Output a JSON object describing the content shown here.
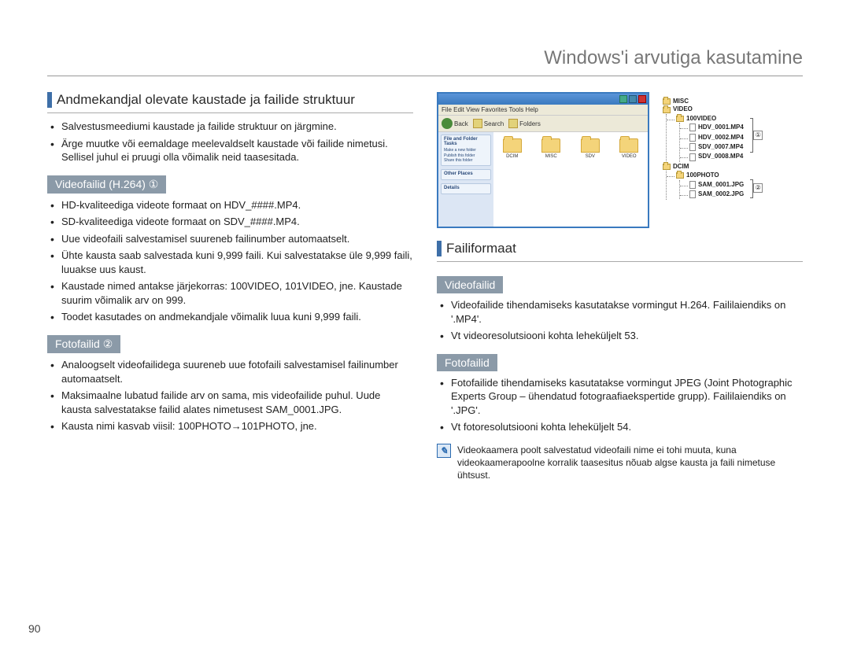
{
  "page_title": "Windows'i arvutiga kasutamine",
  "page_number": "90",
  "left": {
    "section_title": "Andmekandjal olevate kaustade ja failide struktuur",
    "intro_bullets": [
      "Salvestusmeediumi kaustade ja failide struktuur on järgmine.",
      "Ärge muutke või eemaldage meelevaldselt kaustade või failide nimetusi. Sellisel juhul ei pruugi olla võimalik neid taasesitada."
    ],
    "video_sub": "Videofailid (H.264) ①",
    "video_bullets": [
      "HD-kvaliteediga videote formaat on HDV_####.MP4.",
      "SD-kvaliteediga videote formaat on SDV_####.MP4.",
      "Uue videofaili salvestamisel suureneb failinumber automaatselt.",
      "Ühte kausta saab salvestada kuni 9,999 faili. Kui salvestatakse üle 9,999 faili, luuakse uus kaust.",
      "Kaustade nimed antakse järjekorras: 100VIDEO, 101VIDEO, jne. Kaustade suurim võimalik arv on 999.",
      "Toodet kasutades on andmekandjale võimalik luua kuni 9,999 faili."
    ],
    "photo_sub": "Fotofailid ②",
    "photo_bullets": [
      "Analoogselt videofailidega suureneb uue fotofaili salvestamisel failinumber automaatselt.",
      "Maksimaalne lubatud failide arv on sama, mis videofailide puhul. Uude kausta salvestatakse failid alates nimetusest SAM_0001.JPG.",
      "Kausta nimi kasvab viisil: 100PHOTO→101PHOTO, jne."
    ]
  },
  "right": {
    "explorer": {
      "menu": "File  Edit  View  Favorites  Tools  Help",
      "toolbar_back": "Back",
      "toolbar_search": "Search",
      "toolbar_folders": "Folders",
      "side_block1_hdr": "File and Folder Tasks",
      "side_block1_lines": [
        "Make a new folder",
        "Publish this folder",
        "Share this folder"
      ],
      "side_block2_hdr": "Other Places",
      "side_block3_hdr": "Details",
      "folders": [
        "DCIM",
        "MISC",
        "SDV",
        "VIDEO"
      ]
    },
    "tree": {
      "misc": "MISC",
      "video": "VIDEO",
      "v100": "100VIDEO",
      "vfiles": [
        "HDV_0001.MP4",
        "HDV_0002.MP4",
        "SDV_0007.MP4",
        "SDV_0008.MP4"
      ],
      "dcim": "DCIM",
      "p100": "100PHOTO",
      "pfiles": [
        "SAM_0001.JPG",
        "SAM_0002.JPG"
      ],
      "marker1": "①",
      "marker2": "②"
    },
    "failiformat_title": "Failiformaat",
    "videofailid_sub": "Videofailid",
    "videofailid_bullets": [
      "Videofailide tihendamiseks kasutatakse vormingut H.264. Faililaiendiks on '.MP4'.",
      "Vt videoresolutsiooni kohta leheküljelt 53."
    ],
    "fotofailid_sub": "Fotofailid",
    "fotofailid_bullets": [
      "Fotofailide tihendamiseks kasutatakse vormingut JPEG (Joint Photographic Experts Group – ühendatud fotograafiaekspertide grupp). Faililaiendiks on '.JPG'.",
      "Vt fotoresolutsiooni kohta leheküljelt 54."
    ],
    "note": "Videokaamera poolt salvestatud videofaili nime ei tohi muuta, kuna videokaamerapoolne korralik taasesitus nõuab algse kausta ja faili nimetuse ühtsust."
  }
}
